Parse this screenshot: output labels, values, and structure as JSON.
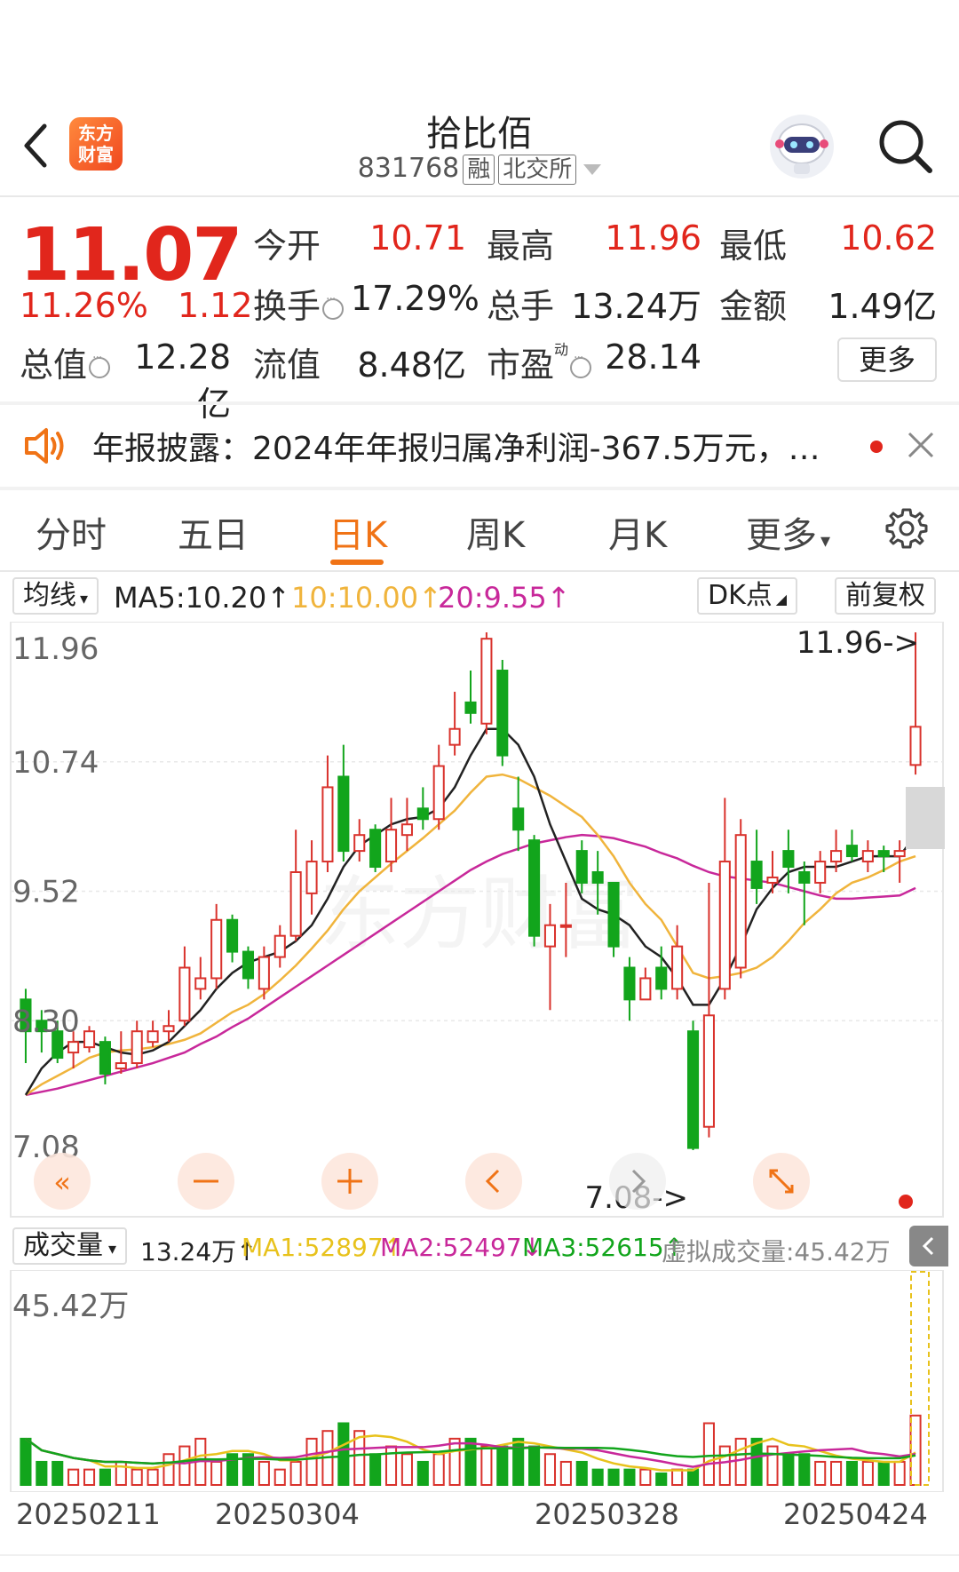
{
  "header": {
    "app_logo_text": "东方财富",
    "stock_name": "拾比佰",
    "stock_code": "831768",
    "tag_margin": "融",
    "tag_exchange": "北交所"
  },
  "quote": {
    "price": "11.07",
    "change_pct": "11.26%",
    "change_abs": "1.12",
    "open_label": "今开",
    "open": "10.71",
    "high_label": "最高",
    "high": "11.96",
    "low_label": "最低",
    "low": "10.62",
    "turnover_label": "换手",
    "turnover": "17.29%",
    "volume_label": "总手",
    "volume": "13.24万",
    "amount_label": "金额",
    "amount": "1.49亿",
    "mktcap_label": "总值",
    "mktcap": "12.28亿",
    "float_label": "流值",
    "float": "8.48亿",
    "pe_label": "市盈",
    "pe_sup": "动",
    "pe": "28.14",
    "more_label": "更多"
  },
  "notice": {
    "text": "年报披露：2024年年报归属净利润-367.5万元，同比..."
  },
  "tabs": [
    {
      "label": "分时"
    },
    {
      "label": "五日"
    },
    {
      "label": "日K"
    },
    {
      "label": "周K"
    },
    {
      "label": "月K"
    },
    {
      "label": "更多"
    }
  ],
  "indicator": {
    "ma_select": "均线",
    "ma5": "MA5:10.20",
    "ma10": "10:10.00",
    "ma20": "20:9.55",
    "dk_label": "DK点",
    "adjust_label": "前复权"
  },
  "kline": {
    "y_labels": [
      "11.96",
      "10.74",
      "9.52",
      "8.30",
      "7.08"
    ],
    "high_marker": "11.96->",
    "low_marker": "7.08->",
    "colors": {
      "up": "#d9322c",
      "down": "#12a51c",
      "ma5": "#222222",
      "ma10": "#f0b43c",
      "ma20": "#c8289a"
    }
  },
  "volume": {
    "select": "成交量",
    "vol": "13.24万",
    "ma1": "MA1:52897",
    "ma2": "MA2:52497",
    "ma3": "MA3:52615",
    "virtual": "虚拟成交量:45.42万",
    "max_label": "45.42万"
  },
  "x_labels": [
    "20250211",
    "20250304",
    "20250328",
    "20250424"
  ],
  "chart_data": {
    "type": "candlestick",
    "ylim": [
      7.08,
      11.96
    ],
    "candles": [
      [
        8.5,
        8.2,
        8.6,
        7.9
      ],
      [
        8.3,
        8.2,
        8.4,
        8.0
      ],
      [
        8.2,
        7.95,
        8.3,
        7.9
      ],
      [
        8.0,
        8.1,
        8.2,
        7.85
      ],
      [
        8.05,
        8.2,
        8.25,
        8.0
      ],
      [
        8.1,
        7.8,
        8.15,
        7.7
      ],
      [
        7.85,
        7.9,
        8.2,
        7.8
      ],
      [
        7.9,
        8.2,
        8.3,
        7.85
      ],
      [
        8.1,
        8.2,
        8.3,
        8.05
      ],
      [
        8.2,
        8.25,
        8.4,
        8.1
      ],
      [
        8.3,
        8.8,
        9.0,
        8.25
      ],
      [
        8.6,
        8.7,
        8.9,
        8.5
      ],
      [
        8.7,
        9.25,
        9.4,
        8.6
      ],
      [
        9.25,
        8.95,
        9.3,
        8.85
      ],
      [
        8.95,
        8.7,
        9.0,
        8.6
      ],
      [
        8.6,
        8.9,
        9.0,
        8.5
      ],
      [
        8.9,
        9.1,
        9.2,
        8.8
      ],
      [
        9.1,
        9.7,
        10.1,
        9.05
      ],
      [
        9.5,
        9.8,
        10.0,
        9.3
      ],
      [
        9.8,
        10.5,
        10.8,
        9.7
      ],
      [
        10.6,
        9.9,
        10.9,
        9.8
      ],
      [
        9.9,
        10.05,
        10.2,
        9.8
      ],
      [
        10.1,
        9.75,
        10.15,
        9.7
      ],
      [
        9.8,
        10.1,
        10.4,
        9.7
      ],
      [
        10.05,
        10.15,
        10.4,
        9.9
      ],
      [
        10.3,
        10.2,
        10.5,
        10.1
      ],
      [
        10.2,
        10.7,
        10.9,
        10.1
      ],
      [
        10.9,
        11.05,
        11.4,
        10.8
      ],
      [
        11.3,
        11.2,
        11.6,
        11.1
      ],
      [
        11.1,
        11.9,
        11.96,
        11.0
      ],
      [
        11.6,
        10.8,
        11.7,
        10.7
      ],
      [
        10.3,
        10.1,
        10.6,
        9.9
      ],
      [
        10.0,
        9.1,
        10.05,
        9.0
      ],
      [
        9.0,
        9.2,
        9.4,
        8.4
      ],
      [
        9.2,
        9.2,
        9.6,
        8.9
      ],
      [
        9.9,
        9.6,
        10.0,
        9.5
      ],
      [
        9.7,
        9.6,
        9.9,
        9.3
      ],
      [
        9.6,
        9.0,
        9.6,
        8.9
      ],
      [
        8.8,
        8.5,
        8.9,
        8.3
      ],
      [
        8.5,
        8.7,
        8.8,
        8.5
      ],
      [
        8.8,
        8.6,
        9.0,
        8.5
      ],
      [
        8.6,
        9.0,
        9.2,
        8.5
      ],
      [
        8.2,
        7.1,
        8.3,
        7.08
      ],
      [
        7.3,
        8.35,
        9.6,
        7.2
      ],
      [
        8.6,
        9.8,
        10.4,
        8.5
      ],
      [
        8.8,
        10.05,
        10.2,
        8.7
      ],
      [
        9.8,
        9.55,
        10.1,
        9.4
      ],
      [
        9.6,
        9.65,
        9.9,
        9.5
      ],
      [
        9.9,
        9.75,
        10.1,
        9.5
      ],
      [
        9.7,
        9.6,
        9.8,
        9.2
      ],
      [
        9.6,
        9.8,
        9.9,
        9.5
      ],
      [
        9.8,
        9.9,
        10.1,
        9.7
      ],
      [
        9.95,
        9.85,
        10.1,
        9.8
      ],
      [
        9.8,
        9.9,
        10.0,
        9.7
      ],
      [
        9.9,
        9.85,
        9.95,
        9.7
      ],
      [
        9.85,
        9.9,
        10.0,
        9.6
      ],
      [
        10.71,
        11.07,
        11.96,
        10.62
      ]
    ],
    "ma5": [
      7.6,
      7.85,
      8.0,
      8.1,
      8.1,
      8.05,
      8.0,
      7.98,
      8.02,
      8.1,
      8.25,
      8.4,
      8.6,
      8.75,
      8.85,
      8.9,
      8.95,
      9.05,
      9.2,
      9.45,
      9.75,
      9.95,
      10.05,
      10.15,
      10.2,
      10.22,
      10.3,
      10.5,
      10.8,
      11.05,
      11.05,
      10.9,
      10.6,
      10.15,
      9.8,
      9.45,
      9.35,
      9.3,
      9.2,
      9.0,
      8.9,
      8.7,
      8.45,
      8.45,
      8.7,
      9.0,
      9.35,
      9.55,
      9.7,
      9.75,
      9.75,
      9.75,
      9.8,
      9.85,
      9.85,
      9.85,
      10.05
    ],
    "ma10": [
      7.6,
      7.7,
      7.78,
      7.86,
      7.95,
      8.0,
      8.02,
      8.03,
      8.05,
      8.08,
      8.12,
      8.18,
      8.28,
      8.38,
      8.45,
      8.55,
      8.68,
      8.82,
      8.98,
      9.15,
      9.35,
      9.52,
      9.65,
      9.78,
      9.9,
      10.02,
      10.15,
      10.28,
      10.45,
      10.6,
      10.62,
      10.58,
      10.5,
      10.42,
      10.32,
      10.22,
      10.05,
      9.85,
      9.6,
      9.4,
      9.25,
      9.0,
      8.75,
      8.7,
      8.72,
      8.75,
      8.8,
      8.9,
      9.05,
      9.22,
      9.35,
      9.5,
      9.6,
      9.65,
      9.72,
      9.8,
      9.85
    ],
    "ma20": [
      7.6,
      7.63,
      7.66,
      7.7,
      7.74,
      7.78,
      7.82,
      7.86,
      7.9,
      7.95,
      8.0,
      8.08,
      8.15,
      8.24,
      8.32,
      8.42,
      8.52,
      8.62,
      8.72,
      8.82,
      8.92,
      9.02,
      9.12,
      9.22,
      9.32,
      9.42,
      9.52,
      9.62,
      9.72,
      9.8,
      9.87,
      9.92,
      9.97,
      10.0,
      10.03,
      10.05,
      10.04,
      10.02,
      9.98,
      9.94,
      9.88,
      9.83,
      9.76,
      9.7,
      9.66,
      9.64,
      9.62,
      9.6,
      9.56,
      9.52,
      9.48,
      9.45,
      9.45,
      9.46,
      9.47,
      9.48,
      9.55
    ],
    "volumes": [
      6,
      3,
      3,
      2,
      2,
      2,
      3,
      2,
      2,
      4,
      5,
      6,
      3,
      4,
      4,
      3,
      2,
      3,
      6,
      7,
      8,
      7,
      4,
      5,
      4,
      3,
      4,
      6,
      6,
      5,
      5,
      6,
      5,
      4,
      3,
      3,
      2,
      2,
      2,
      2,
      1.5,
      2,
      2,
      8,
      5,
      6,
      6,
      5,
      4,
      4,
      3,
      3,
      3,
      3,
      3,
      3,
      9
    ]
  }
}
